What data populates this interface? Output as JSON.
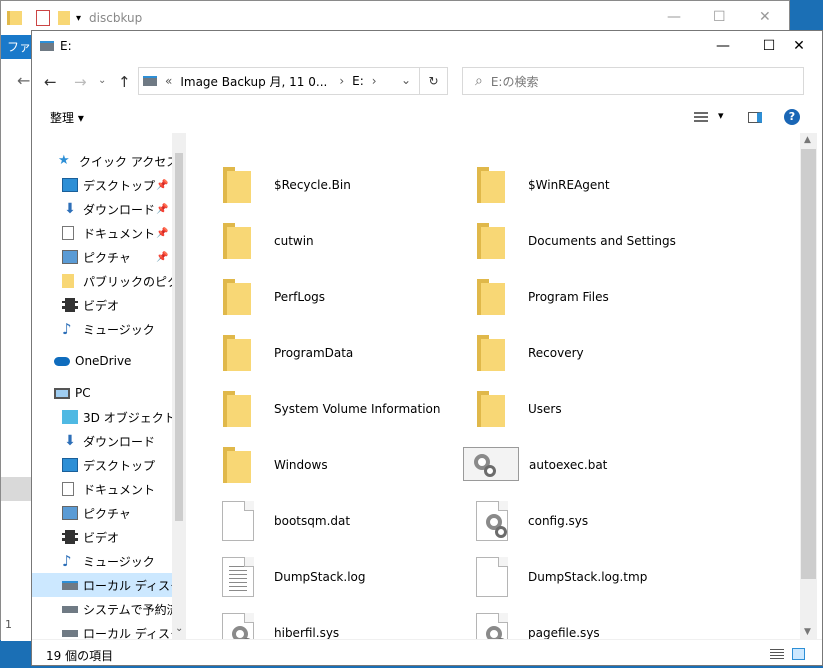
{
  "bg_window": {
    "title": "discbkup",
    "ribbon_tab": "ファ",
    "status_prefix": "1",
    "minimize": "—",
    "maximize": "☐",
    "close": "✕"
  },
  "window": {
    "title": "E:",
    "minimize": "—",
    "maximize": "☐",
    "close": "✕"
  },
  "nav": {
    "back": "←",
    "forward": "→",
    "up": "↑",
    "chevrons": "«",
    "address_1": "Image Backup 月, 11 0...",
    "address_sep_1": "›",
    "address_2": "E:",
    "address_sep_2": "›",
    "dropdown": "⌄",
    "refresh": "↻",
    "search_icon": "⌕",
    "search_placeholder": "E:の検索"
  },
  "toolbar": {
    "organize": "整理 ▾",
    "view_arrow": "▾",
    "help": "?"
  },
  "sidebar": {
    "items": [
      {
        "label": "クイック アクセス"
      },
      {
        "label": "デスクトップ"
      },
      {
        "label": "ダウンロード"
      },
      {
        "label": "ドキュメント"
      },
      {
        "label": "ピクチャ"
      },
      {
        "label": "パブリックのピクチャ"
      },
      {
        "label": "ビデオ"
      },
      {
        "label": "ミュージック"
      },
      {
        "label": "OneDrive"
      },
      {
        "label": "PC"
      },
      {
        "label": "3D オブジェクト"
      },
      {
        "label": "ダウンロード"
      },
      {
        "label": "デスクトップ"
      },
      {
        "label": "ドキュメント"
      },
      {
        "label": "ピクチャ"
      },
      {
        "label": "ビデオ"
      },
      {
        "label": "ミュージック"
      },
      {
        "label": "ローカル ディスク (C"
      },
      {
        "label": "システムで予約済み"
      },
      {
        "label": "ローカル ディスク (E"
      }
    ],
    "pin_glyph": "📌",
    "scroll_down": "⌄"
  },
  "files": [
    {
      "name": "$Recycle.Bin",
      "type": "folder"
    },
    {
      "name": "$WinREAgent",
      "type": "folder"
    },
    {
      "name": "cutwin",
      "type": "folder"
    },
    {
      "name": "Documents and Settings",
      "type": "folder"
    },
    {
      "name": "PerfLogs",
      "type": "folder"
    },
    {
      "name": "Program Files",
      "type": "folder"
    },
    {
      "name": "ProgramData",
      "type": "folder"
    },
    {
      "name": "Recovery",
      "type": "folder"
    },
    {
      "name": "System Volume Information",
      "type": "folder"
    },
    {
      "name": "Users",
      "type": "folder"
    },
    {
      "name": "Windows",
      "type": "folder"
    },
    {
      "name": "autoexec.bat",
      "type": "batch"
    },
    {
      "name": "bootsqm.dat",
      "type": "blank"
    },
    {
      "name": "config.sys",
      "type": "system"
    },
    {
      "name": "DumpStack.log",
      "type": "text"
    },
    {
      "name": "DumpStack.log.tmp",
      "type": "blank"
    },
    {
      "name": "hiberfil.sys",
      "type": "system"
    },
    {
      "name": "pagefile.sys",
      "type": "system"
    }
  ],
  "status": {
    "item_count": "19 個の項目"
  },
  "colors": {
    "desktop": "#1b6fb5",
    "folder": "#f8d775",
    "selection": "#cce8ff",
    "accent": "#0078d7"
  }
}
